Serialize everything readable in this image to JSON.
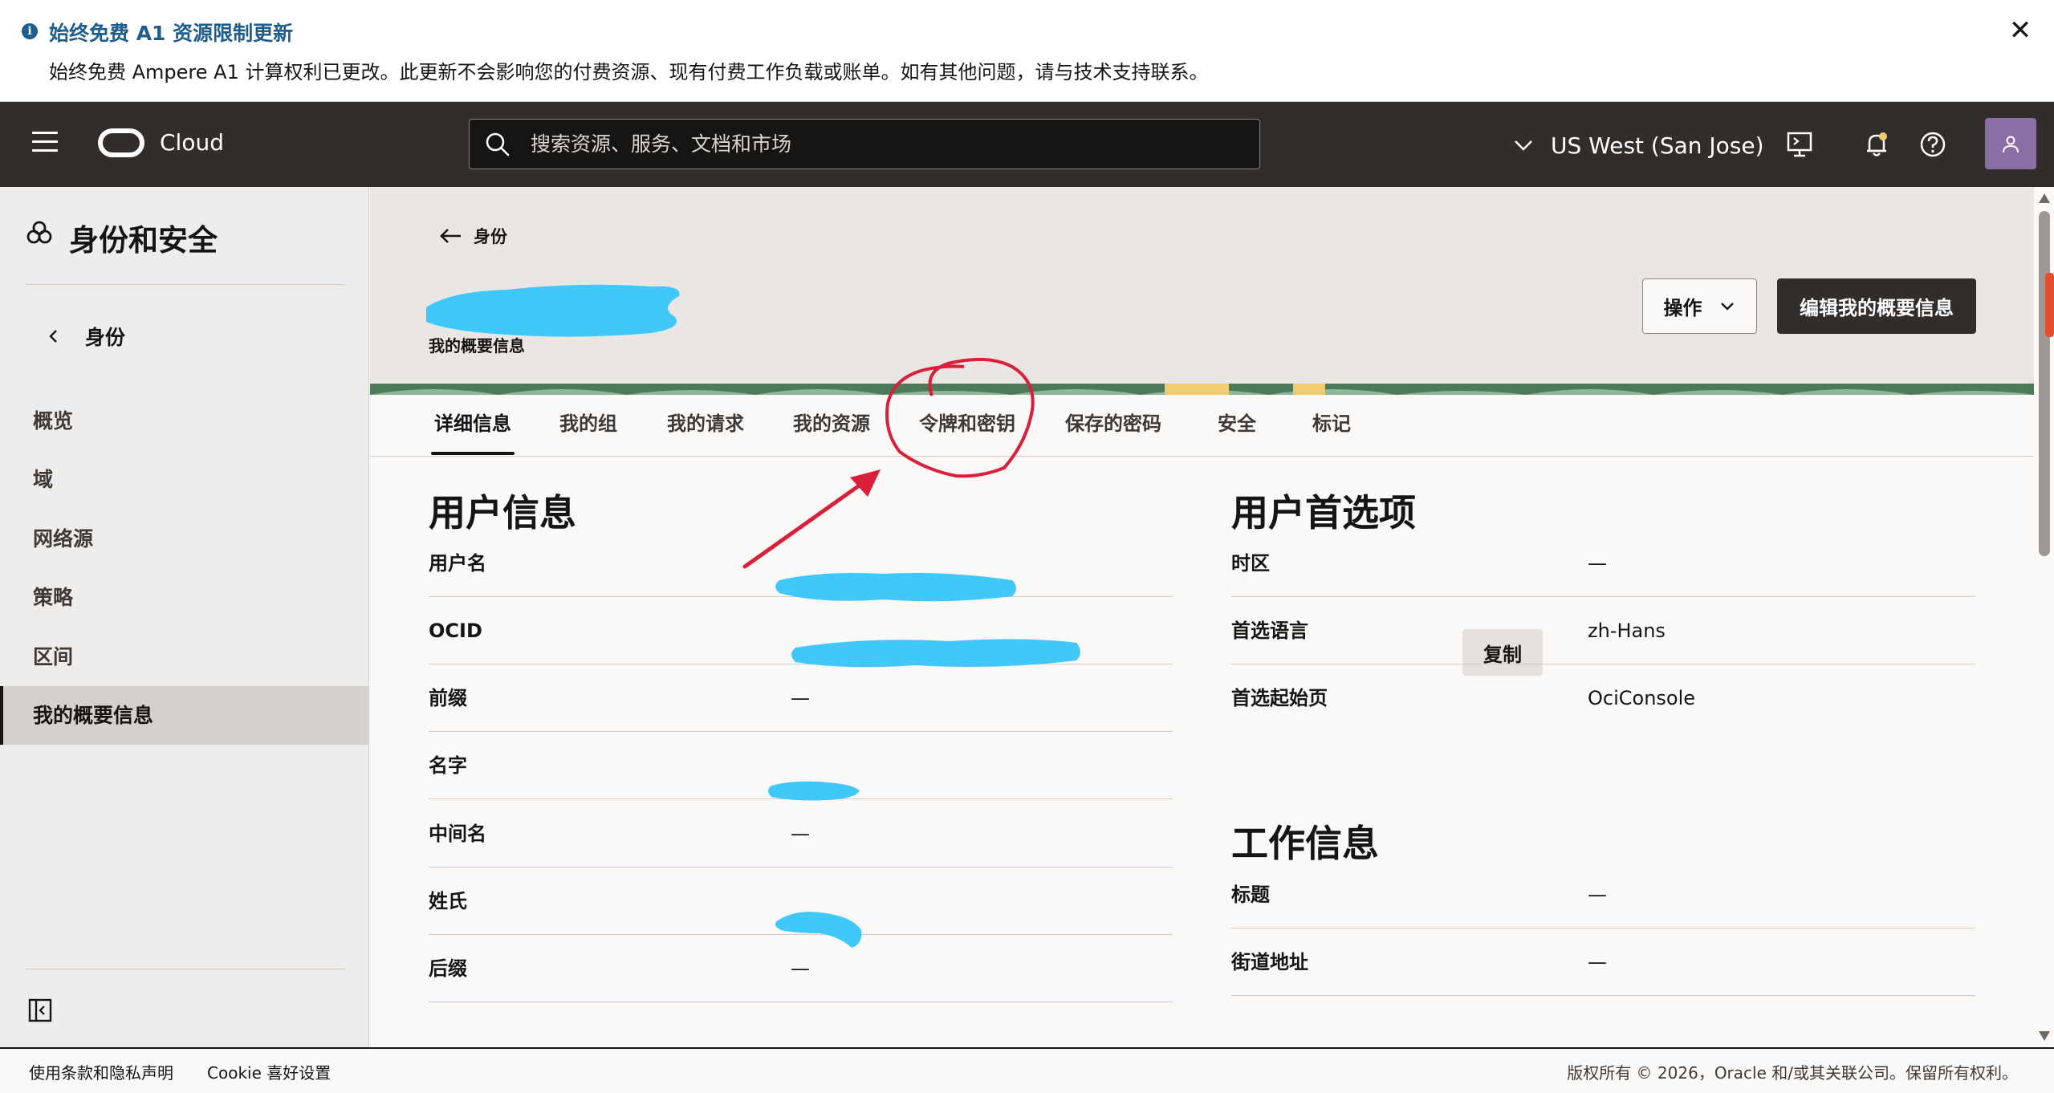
{
  "banner": {
    "title": "始终免费 A1 资源限制更新",
    "text": "始终免费 Ampere A1 计算权利已更改。此更新不会影响您的付费资源、现有付费工作负载或账单。如有其他问题，请与技术支持联系。",
    "close_symbol": "✕"
  },
  "topnav": {
    "logo_text": "Cloud",
    "search_placeholder": "搜索资源、服务、文档和市场",
    "region": "US West (San Jose)",
    "icons": [
      "menu-icon",
      "search-icon",
      "chevron-down-icon",
      "cloud-shell-icon",
      "bell-icon",
      "help-icon",
      "user-icon"
    ]
  },
  "sidebar": {
    "title": "身份和安全",
    "back_label": "身份",
    "items": [
      {
        "label": "概览",
        "active": false
      },
      {
        "label": "域",
        "active": false
      },
      {
        "label": "网络源",
        "active": false
      },
      {
        "label": "策略",
        "active": false
      },
      {
        "label": "区间",
        "active": false
      },
      {
        "label": "我的概要信息",
        "active": true
      }
    ]
  },
  "header": {
    "breadcrumb": "身份",
    "subtitle": "我的概要信息",
    "actions_label": "操作",
    "edit_label": "编辑我的概要信息"
  },
  "tabs": [
    {
      "label": "详细信息",
      "active": true
    },
    {
      "label": "我的组",
      "active": false
    },
    {
      "label": "我的请求",
      "active": false
    },
    {
      "label": "我的资源",
      "active": false
    },
    {
      "label": "令牌和密钥",
      "active": false
    },
    {
      "label": "保存的密码",
      "active": false
    },
    {
      "label": "安全",
      "active": false
    },
    {
      "label": "标记",
      "active": false
    }
  ],
  "user_info": {
    "title": "用户信息",
    "copy_label": "复制",
    "rows": [
      {
        "label": "用户名",
        "value": ""
      },
      {
        "label": "OCID",
        "value": ""
      },
      {
        "label": "前缀",
        "value": "—"
      },
      {
        "label": "名字",
        "value": ""
      },
      {
        "label": "中间名",
        "value": "—"
      },
      {
        "label": "姓氏",
        "value": ""
      },
      {
        "label": "后缀",
        "value": "—"
      }
    ]
  },
  "user_prefs": {
    "title": "用户首选项",
    "rows": [
      {
        "label": "时区",
        "value": "—"
      },
      {
        "label": "首选语言",
        "value": "zh-Hans"
      },
      {
        "label": "首选起始页",
        "value": "OciConsole"
      }
    ]
  },
  "work_info": {
    "title": "工作信息",
    "rows": [
      {
        "label": "标题",
        "value": "—"
      },
      {
        "label": "街道地址",
        "value": "—"
      }
    ]
  },
  "footer": {
    "terms": "使用条款和隐私声明",
    "cookie": "Cookie 喜好设置",
    "copyright": "版权所有 © 2026，Oracle 和/或其关联公司。保留所有权利。"
  },
  "colors": {
    "nav_bg": "#312d2a",
    "banner_accent": "#1e5d8c",
    "redaction": "#40c8fb",
    "annotation": "#d9203a"
  }
}
